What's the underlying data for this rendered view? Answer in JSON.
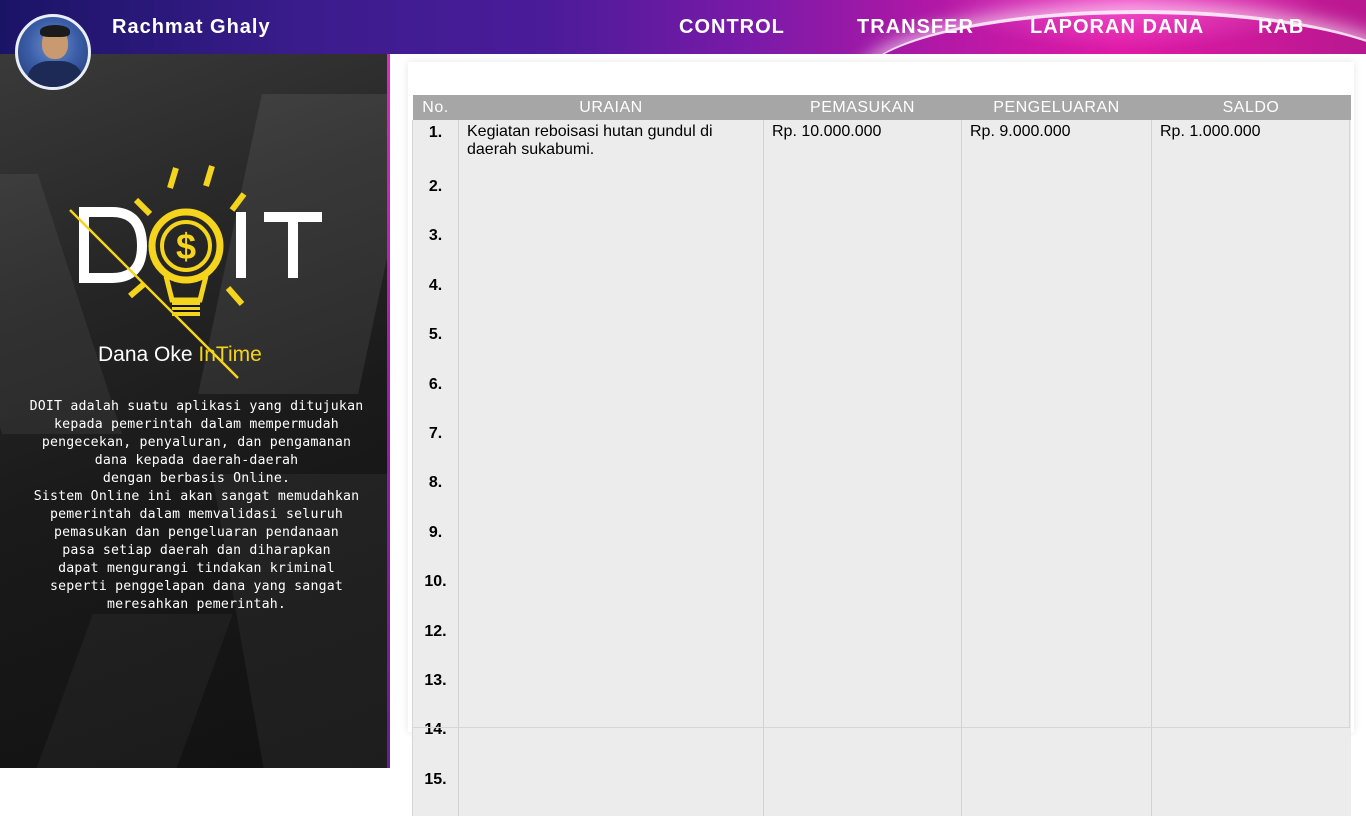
{
  "header": {
    "user_name": "Rachmat Ghaly",
    "nav": [
      "CONTROL",
      "TRANSFER",
      "LAPORAN DANA",
      "RAB"
    ]
  },
  "sidebar": {
    "logo_text": "DOIT",
    "tagline_main": "Dana Oke ",
    "tagline_accent": "InTime",
    "description": "DOIT adalah suatu aplikasi yang ditujukan\nkepada pemerintah dalam mempermudah\npengecekan, penyaluran, dan pengamanan\ndana kepada daerah-daerah\ndengan berbasis Online.\nSistem Online ini akan sangat memudahkan\npemerintah dalam memvalidasi seluruh\npemasukan dan pengeluaran pendanaan\npasa setiap daerah dan diharapkan\ndapat mengurangi tindakan kriminal\nseperti penggelapan dana yang sangat\nmeresahkan pemerintah."
  },
  "table": {
    "headers": [
      "No.",
      "URAIAN",
      "PEMASUKAN",
      "PENGELUARAN",
      "SALDO"
    ],
    "rows": [
      {
        "no": "1.",
        "uraian": "Kegiatan reboisasi hutan gundul di daerah sukabumi.",
        "pemasukan": "Rp. 10.000.000",
        "pengeluaran": "Rp. 9.000.000",
        "saldo": "Rp. 1.000.000"
      },
      {
        "no": "2.",
        "uraian": "",
        "pemasukan": "",
        "pengeluaran": "",
        "saldo": ""
      },
      {
        "no": "3.",
        "uraian": "",
        "pemasukan": "",
        "pengeluaran": "",
        "saldo": ""
      },
      {
        "no": "4.",
        "uraian": "",
        "pemasukan": "",
        "pengeluaran": "",
        "saldo": ""
      },
      {
        "no": "5.",
        "uraian": "",
        "pemasukan": "",
        "pengeluaran": "",
        "saldo": ""
      },
      {
        "no": "6.",
        "uraian": "",
        "pemasukan": "",
        "pengeluaran": "",
        "saldo": ""
      },
      {
        "no": "7.",
        "uraian": "",
        "pemasukan": "",
        "pengeluaran": "",
        "saldo": ""
      },
      {
        "no": "8.",
        "uraian": "",
        "pemasukan": "",
        "pengeluaran": "",
        "saldo": ""
      },
      {
        "no": "9.",
        "uraian": "",
        "pemasukan": "",
        "pengeluaran": "",
        "saldo": ""
      },
      {
        "no": "10.",
        "uraian": "",
        "pemasukan": "",
        "pengeluaran": "",
        "saldo": ""
      },
      {
        "no": "12.",
        "uraian": "",
        "pemasukan": "",
        "pengeluaran": "",
        "saldo": ""
      },
      {
        "no": "13.",
        "uraian": "",
        "pemasukan": "",
        "pengeluaran": "",
        "saldo": ""
      },
      {
        "no": "14.",
        "uraian": "",
        "pemasukan": "",
        "pengeluaran": "",
        "saldo": ""
      },
      {
        "no": "15.",
        "uraian": "",
        "pemasukan": "",
        "pengeluaran": "",
        "saldo": ""
      }
    ]
  },
  "colors": {
    "accent_yellow": "#f4d41c",
    "header_gray": "#a6a6a6",
    "cell_gray": "#ececec"
  }
}
